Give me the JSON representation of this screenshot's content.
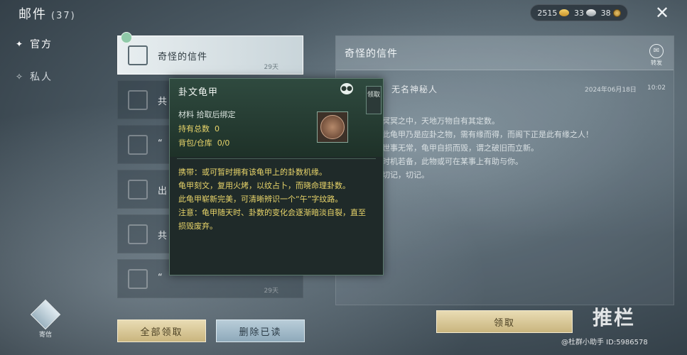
{
  "header": {
    "title": "邮件",
    "count": "(37)",
    "currency": [
      {
        "icon": "gold-ingot-icon",
        "value": "2515"
      },
      {
        "icon": "silver-ingot-icon",
        "value": "33"
      },
      {
        "icon": "copper-coin-icon",
        "value": "38"
      }
    ]
  },
  "nav": {
    "official": "官方",
    "private": "私人"
  },
  "mail_list": [
    {
      "subject": "奇怪的信件",
      "days": "29天",
      "selected": true
    },
    {
      "subject": "共",
      "days": ""
    },
    {
      "subject": "“",
      "days": ""
    },
    {
      "subject": "出",
      "days": ""
    },
    {
      "subject": "共",
      "days": ""
    },
    {
      "subject": "“",
      "days": "29天"
    }
  ],
  "buttons": {
    "claim_all": "全部领取",
    "delete_read": "删除已读",
    "claim": "领取"
  },
  "detail": {
    "title": "奇怪的信件",
    "forward": "转发",
    "sender": "无名神秘人",
    "date": "2024年06月18日",
    "time": "10:02",
    "lines": [
      "冥冥之中，天地万物自有其定数。",
      "此龟甲乃是应卦之物，需有缘而得，而阁下正是此有缘之人！",
      "世事无常，龟甲自损而毁，谓之破旧而立新。",
      "时机若备，此物或可在某事上有助与你。",
      "切记，切记。"
    ]
  },
  "tooltip": {
    "name": "卦文龟甲",
    "side_button": "领取",
    "row1": "材料  拾取后绑定",
    "row2_label": "持有总数",
    "row2_value": "0",
    "row3_label": "背包/仓库",
    "row3_value": "0/0",
    "desc": [
      "携带：或可暂时拥有该龟甲上的卦数机缘。",
      "龟甲刻文，复用火烤，以纹占卜，而晓命理卦数。",
      "此龟甲崭新完美，可清晰辨识一个“午”字纹路。",
      "注意：龟甲随天时、卦数的变化会逐渐暗淡自裂，直至损毁废弃。"
    ]
  },
  "bottom": {
    "icon_label": "寄信"
  },
  "watermark": {
    "title": "推栏",
    "sub": "@杜群小助手 ID:5986578"
  }
}
